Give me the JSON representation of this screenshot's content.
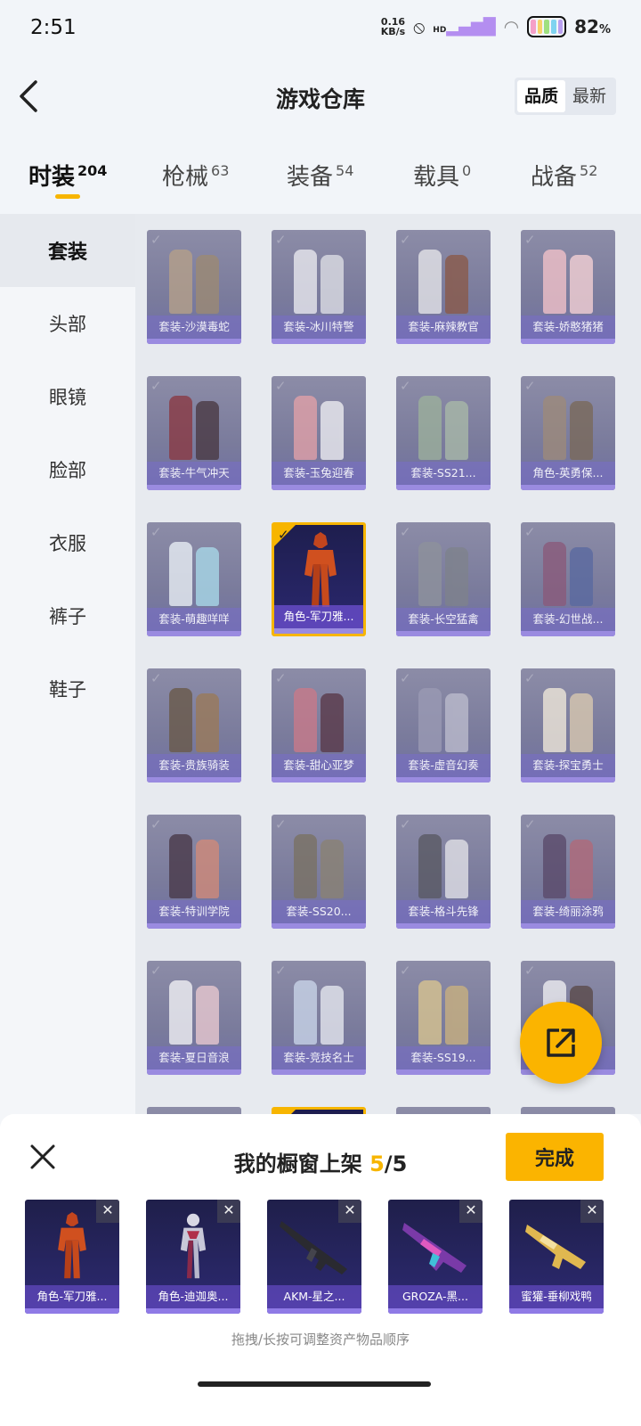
{
  "status": {
    "time": "2:51",
    "net_speed_top": "0.16",
    "net_speed_bottom": "KB/s",
    "network": "HD",
    "battery_pct": "82",
    "battery_unit": "%"
  },
  "header": {
    "title": "游戏仓库",
    "sort_options": [
      "品质",
      "最新"
    ],
    "active_sort": "品质"
  },
  "categories": [
    {
      "label": "时装",
      "count": "204"
    },
    {
      "label": "枪械",
      "count": "63"
    },
    {
      "label": "装备",
      "count": "54"
    },
    {
      "label": "载具",
      "count": "0"
    },
    {
      "label": "战备",
      "count": "52"
    }
  ],
  "side_nav": [
    "套装",
    "头部",
    "眼镜",
    "脸部",
    "衣服",
    "裤子",
    "鞋子"
  ],
  "items": [
    {
      "label": "套装-沙漠毒蛇"
    },
    {
      "label": "套装-冰川特警"
    },
    {
      "label": "套装-麻辣教官"
    },
    {
      "label": "套装-娇憨猪猪"
    },
    {
      "label": "套装-牛气冲天"
    },
    {
      "label": "套装-玉兔迎春"
    },
    {
      "label": "套装-SS21..."
    },
    {
      "label": "角色-英勇保..."
    },
    {
      "label": "套装-萌趣咩咩"
    },
    {
      "label": "角色-军刀雅..."
    },
    {
      "label": "套装-长空猛禽"
    },
    {
      "label": "套装-幻世战..."
    },
    {
      "label": "套装-贵族骑装"
    },
    {
      "label": "套装-甜心亚梦"
    },
    {
      "label": "套装-虚音幻奏"
    },
    {
      "label": "套装-探宝勇士"
    },
    {
      "label": "套装-特训学院"
    },
    {
      "label": "套装-SS20..."
    },
    {
      "label": "套装-格斗先锋"
    },
    {
      "label": "套装-绮丽涂鸦"
    },
    {
      "label": "套装-夏日音浪"
    },
    {
      "label": "套装-竞技名士"
    },
    {
      "label": "套装-SS19..."
    },
    {
      "label": ""
    }
  ],
  "sheet": {
    "title": "我的橱窗上架",
    "count": "5",
    "total": "/5",
    "done_label": "完成",
    "hint": "拖拽/长按可调整资产物品顺序",
    "shelf_items": [
      "角色-军刀雅...",
      "角色-迪迦奥...",
      "AKM-星之...",
      "GROZA-黑...",
      "蜜獾-垂柳戏鸭"
    ],
    "remove_glyph": "✕"
  },
  "colors": {
    "accent": "#f7b500",
    "card_purple": "#7a7b9c",
    "label_band": "#9a8be0"
  }
}
